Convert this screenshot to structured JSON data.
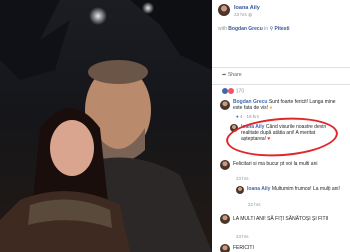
{
  "post": {
    "author": "Ioana Aily",
    "time": "23 hrs",
    "with_text": "with",
    "tagged": "Bogdan Grecu",
    "in_text": "in",
    "place": "Pitesti",
    "share_label": "Share",
    "reaction_count": "170"
  },
  "comments": [
    {
      "author": "Bogdan Grecu",
      "text": "Sunt foarte fericit! Langa mine este fata de vis!",
      "meta": "4  ·  19 hrs"
    },
    {
      "author": "Ioana Aily",
      "text": "Când visurile noastre devin realitate după atâtia ani! A meritat așteptarea!",
      "meta": ""
    },
    {
      "author": "",
      "text": "Felicitari si ma bucur pt voi la multi ani",
      "meta": "23 hrs"
    },
    {
      "author": "Ioana Aily",
      "text": "Multumim frumos! La mulți ani!",
      "meta": "22 hrs"
    },
    {
      "author": "",
      "text": "LA MULTI ANI! SĂ FIȚI SĂNĂTOȘI ȘI FITII",
      "meta": "23 hrs"
    },
    {
      "author": "",
      "text": "FERICITI",
      "meta": ""
    }
  ],
  "colors": {
    "accent": "#385898",
    "highlight": "#e0282b",
    "heart": "#f25268"
  }
}
